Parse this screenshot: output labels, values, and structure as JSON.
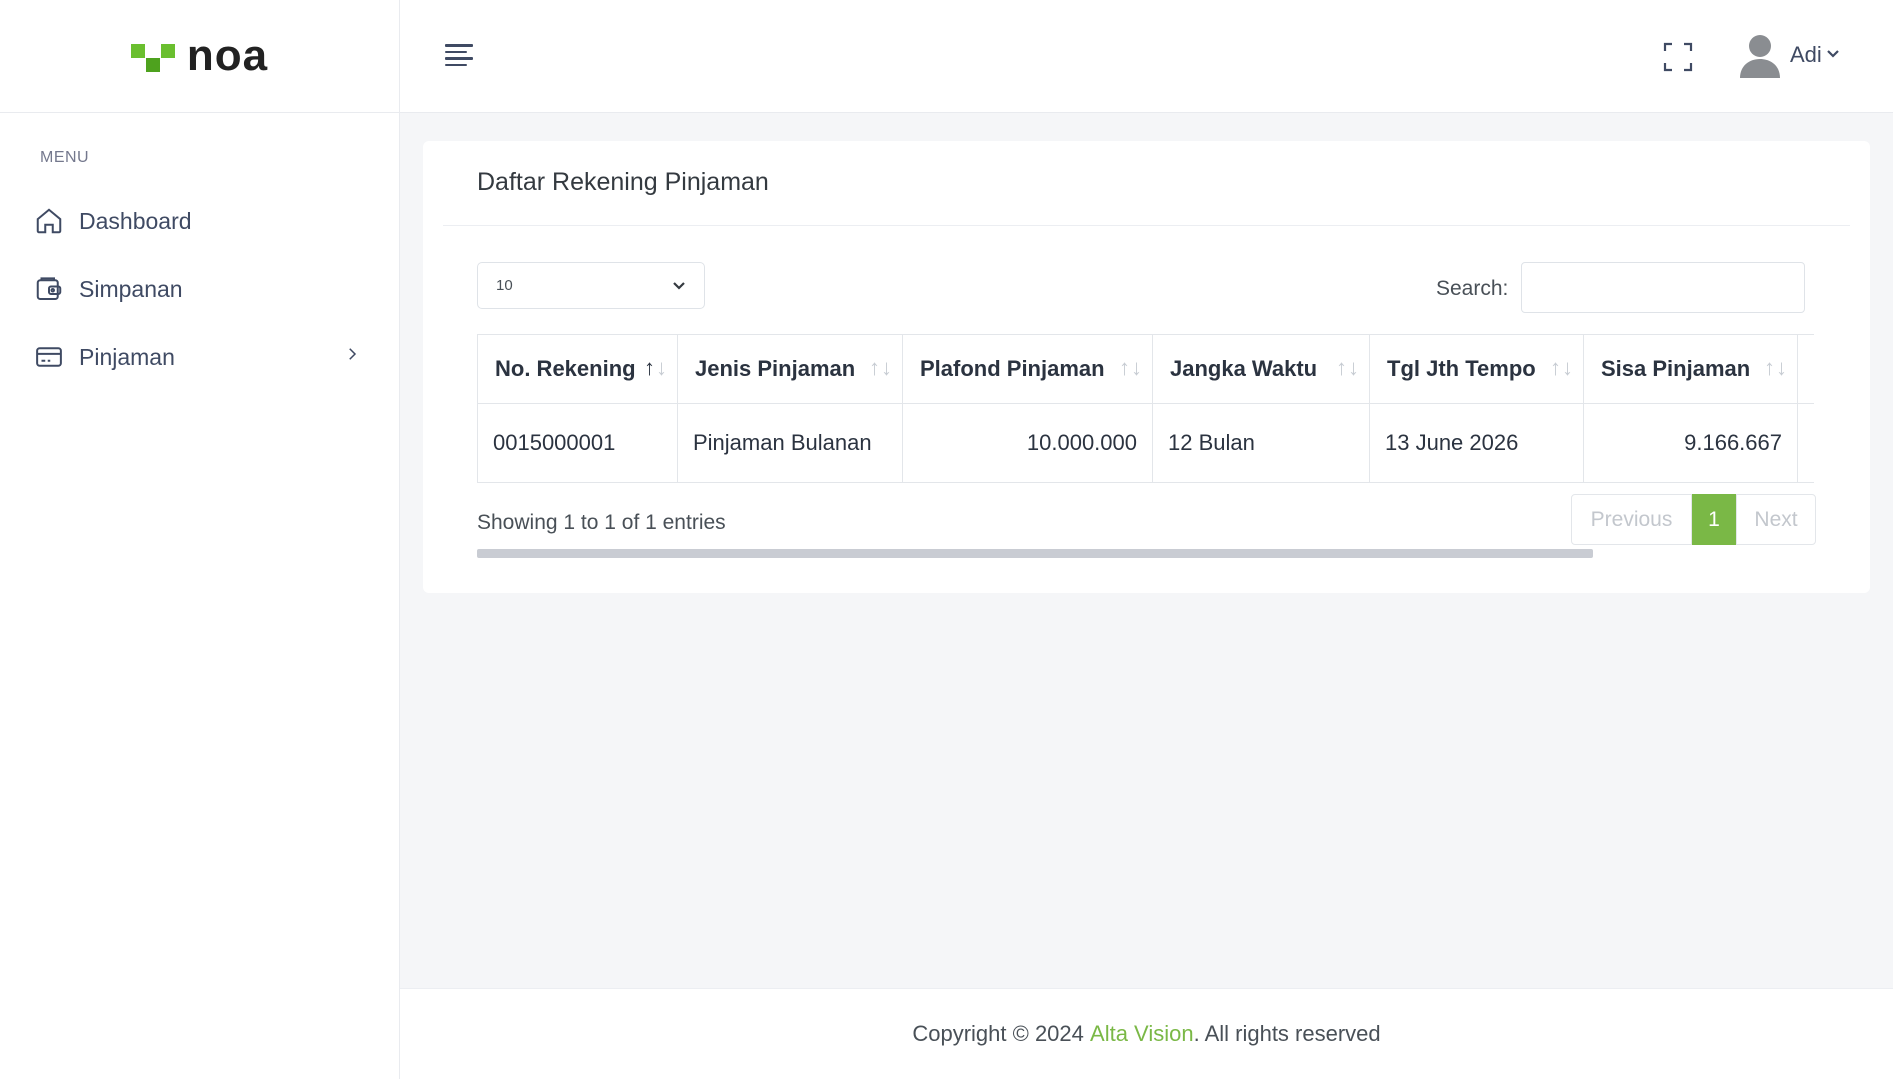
{
  "app": {
    "logo_text": "noa",
    "brand_color": "#7ab846"
  },
  "sidebar": {
    "menu_title": "MENU",
    "items": [
      {
        "label": "Dashboard",
        "icon": "home-icon"
      },
      {
        "label": "Simpanan",
        "icon": "wallet-icon"
      },
      {
        "label": "Pinjaman",
        "icon": "credit-card-icon",
        "has_submenu": true
      }
    ]
  },
  "topbar": {
    "user_name": "Adi"
  },
  "card": {
    "title": "Daftar Rekening Pinjaman",
    "page_length": "10",
    "search_label": "Search:",
    "search_value": "",
    "table": {
      "columns": [
        "No. Rekening",
        "Jenis Pinjaman",
        "Plafond Pinjaman",
        "Jangka Waktu",
        "Tgl Jth Tempo",
        "Sisa Pinjaman"
      ],
      "rows": [
        [
          "0015000001",
          "Pinjaman Bulanan",
          "10.000.000",
          "12 Bulan",
          "13 June 2026",
          "9.166.667"
        ]
      ]
    },
    "info": "Showing 1 to 1 of 1 entries",
    "pagination": {
      "previous": "Previous",
      "current": "1",
      "next": "Next"
    }
  },
  "footer": {
    "prefix": "Copyright © 2024 ",
    "brand": "Alta Vision",
    "suffix": ". All rights reserved"
  }
}
